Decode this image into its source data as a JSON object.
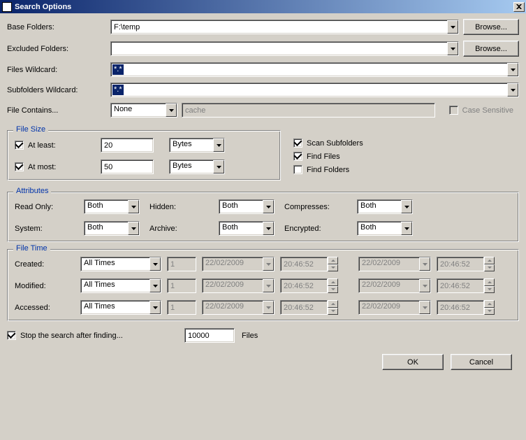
{
  "window": {
    "title": "Search Options"
  },
  "fields": {
    "base_folders_label": "Base Folders:",
    "base_folders_value": "F:\\temp",
    "excluded_folders_label": "Excluded Folders:",
    "excluded_folders_value": "",
    "files_wildcard_label": "Files Wildcard:",
    "files_wildcard_value": "*.*",
    "subfolders_wildcard_label": "Subfolders Wildcard:",
    "subfolders_wildcard_value": "*.*",
    "file_contains_label": "File Contains...",
    "file_contains_mode": "None",
    "file_contains_value": "cache",
    "case_sensitive_label": "Case Sensitive"
  },
  "buttons": {
    "browse": "Browse...",
    "ok": "OK",
    "cancel": "Cancel"
  },
  "file_size": {
    "legend": "File Size",
    "at_least_label": "At least:",
    "at_least_value": "20",
    "at_least_unit": "Bytes",
    "at_most_label": "At most:",
    "at_most_value": "50",
    "at_most_unit": "Bytes",
    "scan_subfolders_label": "Scan Subfolders",
    "find_files_label": "Find Files",
    "find_folders_label": "Find Folders"
  },
  "attributes": {
    "legend": "Attributes",
    "read_only_label": "Read Only:",
    "read_only_value": "Both",
    "hidden_label": "Hidden:",
    "hidden_value": "Both",
    "compresses_label": "Compresses:",
    "compresses_value": "Both",
    "system_label": "System:",
    "system_value": "Both",
    "archive_label": "Archive:",
    "archive_value": "Both",
    "encrypted_label": "Encrypted:",
    "encrypted_value": "Both"
  },
  "file_time": {
    "legend": "File Time",
    "created_label": "Created:",
    "modified_label": "Modified:",
    "accessed_label": "Accessed:",
    "mode": "All Times",
    "num": "1",
    "date": "22/02/2009",
    "time": "20:46:52"
  },
  "stop_after": {
    "label": "Stop the search after finding...",
    "value": "10000",
    "unit": "Files"
  }
}
